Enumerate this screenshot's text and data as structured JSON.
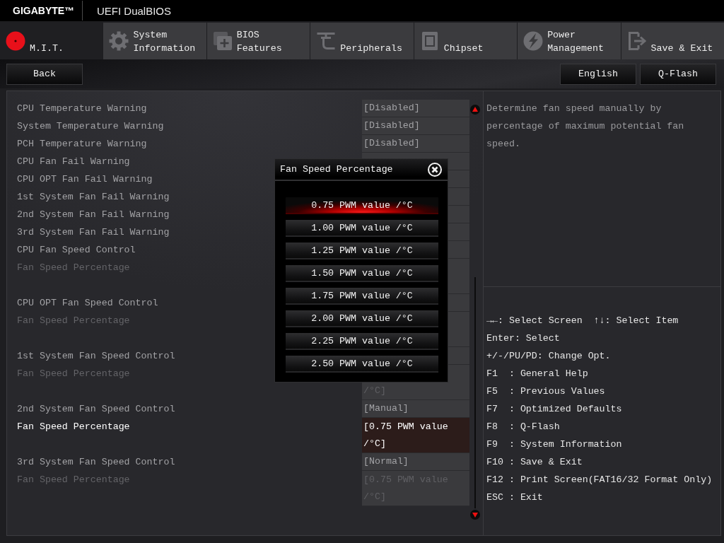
{
  "header": {
    "logo": "GIGABYTE™",
    "title": "UEFI DualBIOS"
  },
  "tabs": [
    {
      "label": "M.I.T.",
      "selected": true
    },
    {
      "label": "System Information",
      "selected": false
    },
    {
      "label": "BIOS Features",
      "selected": false
    },
    {
      "label": "Peripherals",
      "selected": false
    },
    {
      "label": "Chipset",
      "selected": false
    },
    {
      "label": "Power Management",
      "selected": false
    },
    {
      "label": "Save & Exit",
      "selected": false
    }
  ],
  "toolbar": {
    "left_buttons": [
      "Back"
    ],
    "right_buttons": [
      "English",
      "Q-Flash"
    ]
  },
  "settings": {
    "groups": [
      {
        "rows": [
          {
            "label": "CPU Temperature Warning",
            "value": "[Disabled]",
            "selected": false,
            "disabled": false
          },
          {
            "label": "System Temperature Warning",
            "value": "[Disabled]",
            "selected": false,
            "disabled": false
          },
          {
            "label": "PCH Temperature Warning",
            "value": "[Disabled]",
            "selected": false,
            "disabled": false
          },
          {
            "label": "CPU Fan Fail Warning",
            "selected": false,
            "disabled": false
          },
          {
            "label": "CPU OPT Fan Fail Warning",
            "selected": false,
            "disabled": false
          },
          {
            "label": "1st System Fan Fail Warning",
            "selected": false,
            "disabled": false
          },
          {
            "label": "2nd System Fan Fail Warning",
            "selected": false,
            "disabled": false
          },
          {
            "label": "3rd System Fan Fail Warning",
            "selected": false,
            "disabled": false
          },
          {
            "label": "CPU Fan Speed Control",
            "selected": false,
            "disabled": false
          },
          {
            "label": "Fan Speed Percentage",
            "selected": false,
            "disabled": true
          }
        ]
      },
      {
        "rows": [
          {
            "label": "CPU OPT Fan Speed Control",
            "selected": false,
            "disabled": false
          },
          {
            "label": "Fan Speed Percentage",
            "selected": false,
            "disabled": true
          }
        ]
      },
      {
        "rows": [
          {
            "label": "1st System Fan Speed Control",
            "selected": false,
            "disabled": false
          },
          {
            "label": "Fan Speed Percentage",
            "value": "/°C]",
            "selected": false,
            "disabled": true
          }
        ]
      },
      {
        "rows": [
          {
            "label": "2nd System Fan Speed Control",
            "value": "[Manual]",
            "selected": false,
            "disabled": false
          },
          {
            "label": "Fan Speed Percentage",
            "value": "[0.75 PWM value /°C]",
            "selected": true,
            "disabled": false
          }
        ]
      },
      {
        "rows": [
          {
            "label": "3rd System Fan Speed Control",
            "value": "[Normal]",
            "selected": false,
            "disabled": false
          },
          {
            "label": "Fan Speed Percentage",
            "value": "[0.75 PWM value /°C]",
            "selected": false,
            "disabled": true
          }
        ]
      }
    ]
  },
  "popup": {
    "title": "Fan Speed Percentage",
    "options": [
      {
        "label": "0.75 PWM value /°C",
        "selected": true
      },
      {
        "label": "1.00 PWM value /°C",
        "selected": false
      },
      {
        "label": "1.25 PWM value /°C",
        "selected": false
      },
      {
        "label": "1.50 PWM value /°C",
        "selected": false
      },
      {
        "label": "1.75 PWM value /°C",
        "selected": false
      },
      {
        "label": "2.00 PWM value /°C",
        "selected": false
      },
      {
        "label": "2.25 PWM value /°C",
        "selected": false
      },
      {
        "label": "2.50 PWM value /°C",
        "selected": false
      }
    ]
  },
  "help": {
    "description": "Determine fan speed manually by percentage of maximum potential fan speed.",
    "shortcuts": [
      [
        "→←: Select Screen",
        "↑↓: Select Item"
      ],
      [
        "Enter: Select"
      ],
      [
        "+/-/PU/PD: Change Opt."
      ],
      [
        "F1  : General Help"
      ],
      [
        "F5  : Previous Values"
      ],
      [
        "F7  : Optimized Defaults"
      ],
      [
        "F8  : Q-Flash"
      ],
      [
        "F9  : System Information"
      ],
      [
        "F10 : Save & Exit"
      ],
      [
        "F12 : Print Screen(FAT16/32 Format Only)"
      ],
      [
        "ESC : Exit"
      ]
    ]
  }
}
